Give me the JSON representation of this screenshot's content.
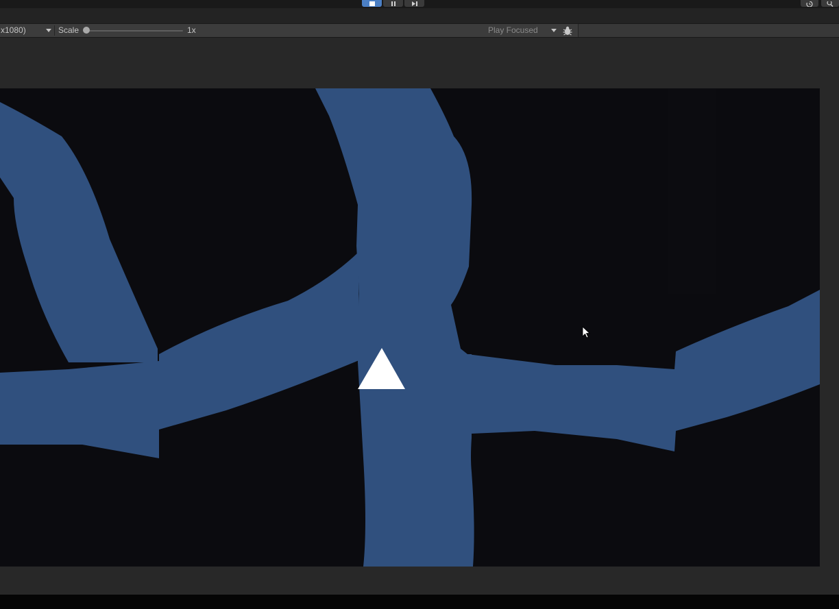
{
  "toolbar": {
    "play_controls": [
      {
        "name": "stop-icon",
        "state": "active"
      },
      {
        "name": "pause-icon",
        "state": "idle"
      },
      {
        "name": "step-icon",
        "state": "idle"
      }
    ],
    "right_icons": [
      "history-icon",
      "search-icon"
    ]
  },
  "game_toolbar": {
    "resolution_label": "x1080)",
    "scale_label": "Scale",
    "scale_value": "1x",
    "scale_fraction": 0.0,
    "play_mode_label": "Play Focused",
    "debug_icon": "bug-icon"
  },
  "scene": {
    "background_color": "#0b0b0f",
    "path_color": "#30507e",
    "player_color": "#ffffff",
    "player_shape": "triangle"
  },
  "colors": {
    "accent": "#4b7fc4"
  }
}
